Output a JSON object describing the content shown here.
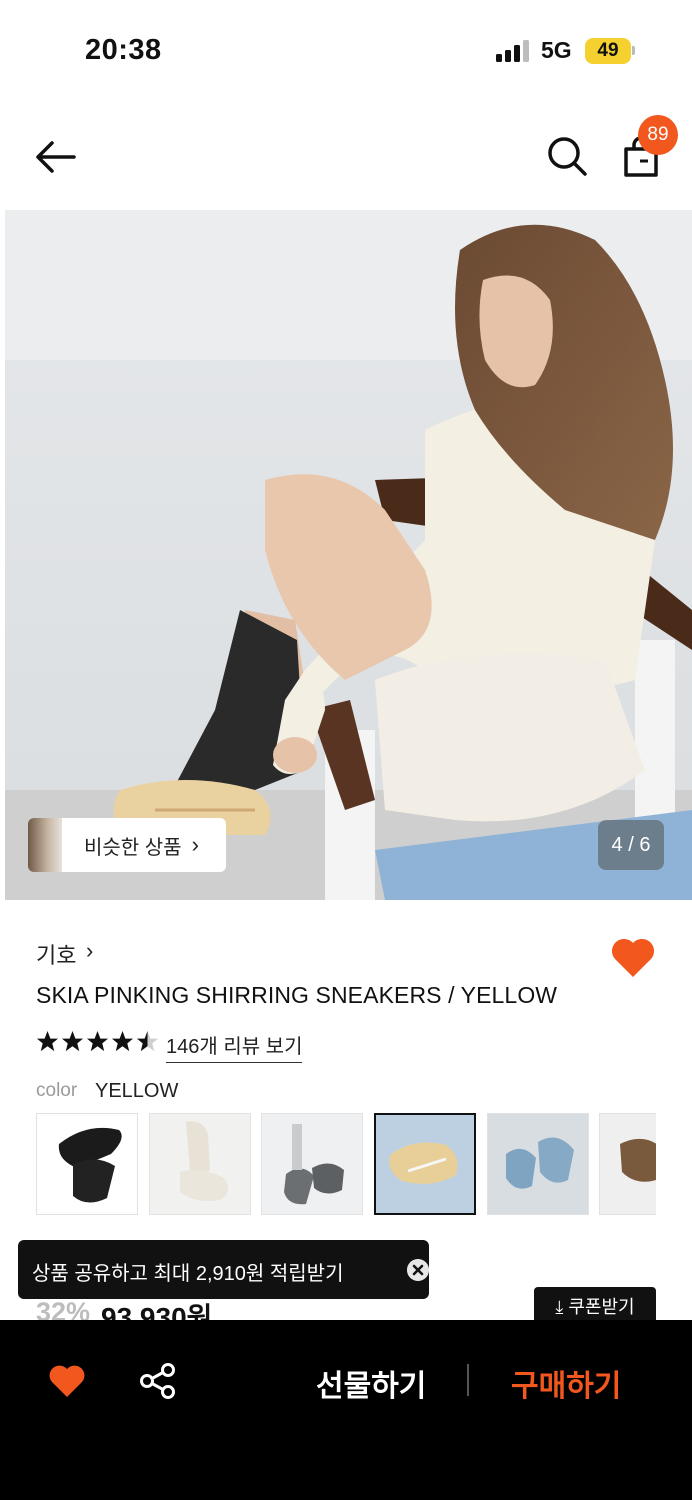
{
  "status_bar": {
    "time": "20:38",
    "network": "5G",
    "battery": "49"
  },
  "header": {
    "cart_count": "89"
  },
  "gallery": {
    "similar_label": "비슷한 상품",
    "similar_chevron": "›",
    "page_indicator": "4 / 6"
  },
  "product": {
    "brand": "기호",
    "brand_chevron": "›",
    "title": "SKIA PINKING SHIRRING SNEAKERS / YELLOW",
    "rating": 4.5,
    "review_link": "146개 리뷰 보기",
    "color_label": "color",
    "color_value": "YELLOW",
    "liked": true
  },
  "swatches": [
    {
      "color": "black",
      "selected": false
    },
    {
      "color": "white",
      "selected": false
    },
    {
      "color": "grey",
      "selected": false
    },
    {
      "color": "yellow",
      "selected": true
    },
    {
      "color": "blue",
      "selected": false
    },
    {
      "color": "brown",
      "selected": false
    }
  ],
  "toast": {
    "text": "상품 공유하고 최대 2,910원 적립받기"
  },
  "pricing": {
    "discount": "32%",
    "price": "93,930원",
    "coupon_button": "⤓ 쿠폰받기"
  },
  "bottom_bar": {
    "gift_label": "선물하기",
    "buy_label": "구매하기"
  },
  "colors": {
    "accent": "#f2571e",
    "bar": "#000000",
    "battery": "#f4d12f"
  }
}
